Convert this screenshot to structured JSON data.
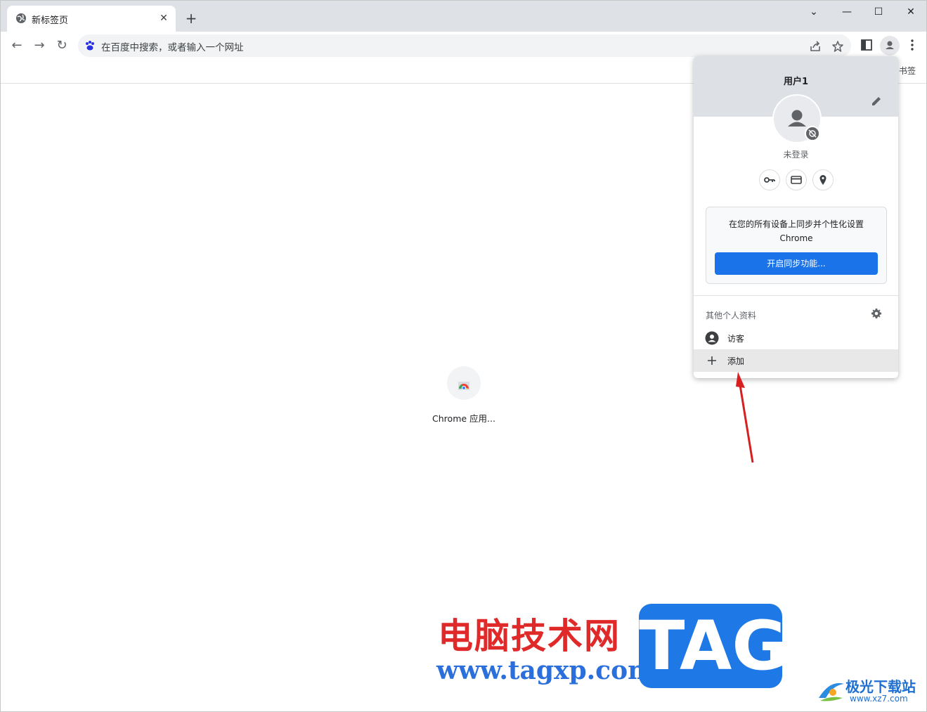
{
  "tab": {
    "title": "新标签页",
    "close": "✕",
    "new": "+"
  },
  "window_controls": {
    "tabsearch": "⌄",
    "minimize": "—",
    "maximize": "☐",
    "close": "✕"
  },
  "nav": {
    "back": "←",
    "forward": "→",
    "reload": "↻"
  },
  "omnibox": {
    "placeholder": "在百度中搜索，或者输入一个网址"
  },
  "bookmarks": {
    "partial_text": "书签"
  },
  "shortcut": {
    "label": "Chrome 应用..."
  },
  "profile_menu": {
    "username": "用户1",
    "status": "未登录",
    "sync_text_line1": "在您的所有设备上同步并个性化设置",
    "sync_text_line2": "Chrome",
    "sync_button": "开启同步功能...",
    "other_profiles_label": "其他个人资料",
    "items": [
      {
        "label": "访客",
        "icon": "person-icon"
      },
      {
        "label": "添加",
        "icon": "plus-icon"
      }
    ]
  },
  "watermark": {
    "cn": "电脑技术网",
    "url": "www.tagxp.com",
    "tag": "TAG",
    "jg_cn": "极光下载站",
    "jg_url": "www.xz7.com"
  },
  "colors": {
    "accent": "#1a73e8",
    "arrow": "#d71f1f",
    "tabstrip": "#dee1e6"
  }
}
